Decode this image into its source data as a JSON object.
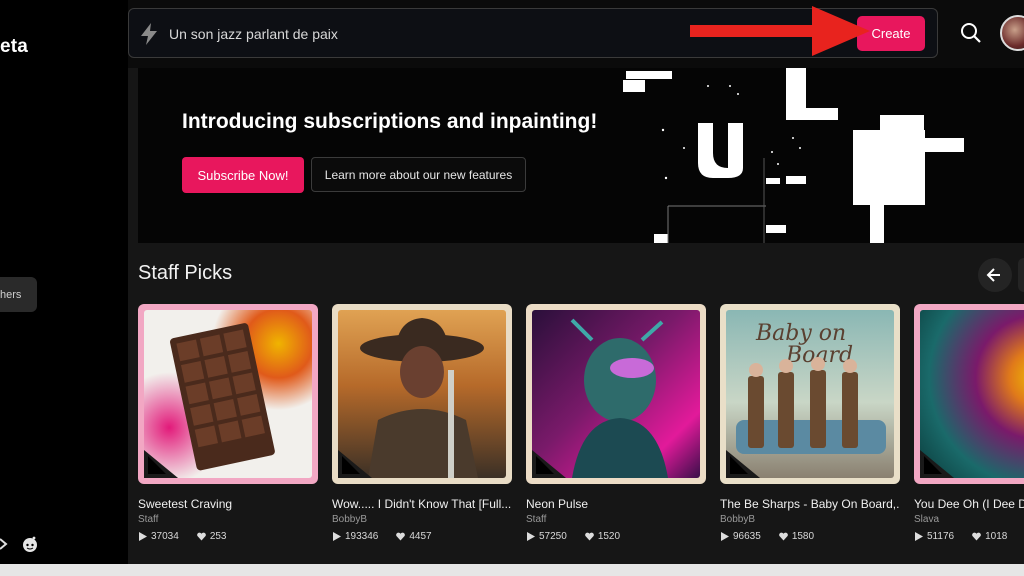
{
  "sidebar": {
    "brand": "eta",
    "pill_label": "hers"
  },
  "search": {
    "value": "Un son jazz parlant de paix",
    "create_label": "Create"
  },
  "banner": {
    "title": "Introducing subscriptions and inpainting!",
    "subscribe_label": "Subscribe Now!",
    "learn_label": "Learn more about our new features"
  },
  "staff_picks": {
    "title": "Staff Picks",
    "cards": [
      {
        "title": "Sweetest Craving",
        "author": "Staff",
        "plays": "37034",
        "likes": "253",
        "frame_color": "#f2a7c3"
      },
      {
        "title": "Wow..... I Didn't Know That [Full...",
        "author": "BobbyB",
        "plays": "193346",
        "likes": "4457",
        "frame_color": "#e9dcc5"
      },
      {
        "title": "Neon Pulse",
        "author": "Staff",
        "plays": "57250",
        "likes": "1520",
        "frame_color": "#ecdcc6"
      },
      {
        "title": "The Be Sharps - Baby On Board,...",
        "author": "BobbyB",
        "plays": "96635",
        "likes": "1580",
        "frame_color": "#e9dfc8"
      },
      {
        "title": "You Dee Oh (I Dee D",
        "author": "Slava",
        "plays": "51176",
        "likes": "1018",
        "frame_color": "#f2a7c3"
      }
    ]
  },
  "colors": {
    "accent": "#e8175d",
    "arrow": "#e8231e"
  }
}
